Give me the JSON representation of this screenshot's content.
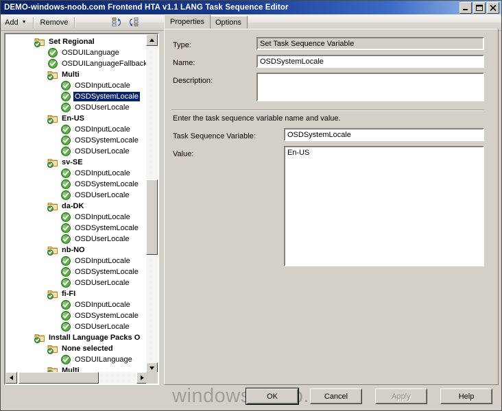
{
  "window": {
    "title": "DEMO-windows-noob.com Frontend HTA v1.1 LANG Task Sequence Editor",
    "minimize_label": "Minimize",
    "maximize_label": "Maximize",
    "close_label": "Close"
  },
  "toolbar": {
    "add_label": "Add",
    "add_caret": "▼",
    "remove_label": "Remove",
    "icon1_name": "move-up-icon",
    "icon2_name": "move-down-icon"
  },
  "tree": {
    "rows": [
      {
        "label": "Set Regional",
        "indent": 1,
        "type": "folder",
        "selected": false
      },
      {
        "label": "OSDUILanguage",
        "indent": 2,
        "type": "step",
        "selected": false
      },
      {
        "label": "OSDUILanguageFallback",
        "indent": 2,
        "type": "step",
        "selected": false
      },
      {
        "label": "Multi",
        "indent": 2,
        "type": "folder",
        "selected": false
      },
      {
        "label": "OSDInputLocale",
        "indent": 3,
        "type": "step",
        "selected": false
      },
      {
        "label": "OSDSystemLocale",
        "indent": 3,
        "type": "step",
        "selected": true
      },
      {
        "label": "OSDUserLocale",
        "indent": 3,
        "type": "step",
        "selected": false
      },
      {
        "label": "En-US",
        "indent": 2,
        "type": "folder",
        "selected": false
      },
      {
        "label": "OSDInputLocale",
        "indent": 3,
        "type": "step",
        "selected": false
      },
      {
        "label": "OSDSystemLocale",
        "indent": 3,
        "type": "step",
        "selected": false
      },
      {
        "label": "OSDUserLocale",
        "indent": 3,
        "type": "step",
        "selected": false
      },
      {
        "label": "sv-SE",
        "indent": 2,
        "type": "folder",
        "selected": false
      },
      {
        "label": "OSDInputLocale",
        "indent": 3,
        "type": "step",
        "selected": false
      },
      {
        "label": "OSDSystemLocale",
        "indent": 3,
        "type": "step",
        "selected": false
      },
      {
        "label": "OSDUserLocale",
        "indent": 3,
        "type": "step",
        "selected": false
      },
      {
        "label": "da-DK",
        "indent": 2,
        "type": "folder",
        "selected": false
      },
      {
        "label": "OSDInputLocale",
        "indent": 3,
        "type": "step",
        "selected": false
      },
      {
        "label": "OSDSystemLocale",
        "indent": 3,
        "type": "step",
        "selected": false
      },
      {
        "label": "OSDUserLocale",
        "indent": 3,
        "type": "step",
        "selected": false
      },
      {
        "label": "nb-NO",
        "indent": 2,
        "type": "folder",
        "selected": false
      },
      {
        "label": "OSDInputLocale",
        "indent": 3,
        "type": "step",
        "selected": false
      },
      {
        "label": "OSDSystemLocale",
        "indent": 3,
        "type": "step",
        "selected": false
      },
      {
        "label": "OSDUserLocale",
        "indent": 3,
        "type": "step",
        "selected": false
      },
      {
        "label": "fi-FI",
        "indent": 2,
        "type": "folder",
        "selected": false
      },
      {
        "label": "OSDInputLocale",
        "indent": 3,
        "type": "step",
        "selected": false
      },
      {
        "label": "OSDSystemLocale",
        "indent": 3,
        "type": "step",
        "selected": false
      },
      {
        "label": "OSDUserLocale",
        "indent": 3,
        "type": "step",
        "selected": false
      },
      {
        "label": "Install Language Packs O",
        "indent": 1,
        "type": "folder",
        "selected": false
      },
      {
        "label": "None selected",
        "indent": 2,
        "type": "folder",
        "selected": false
      },
      {
        "label": "OSDUILanguage",
        "indent": 3,
        "type": "step",
        "selected": false
      },
      {
        "label": "Multi",
        "indent": 2,
        "type": "folder",
        "selected": false
      }
    ]
  },
  "tabs": [
    {
      "label": "Properties",
      "active": true
    },
    {
      "label": "Options",
      "active": false
    }
  ],
  "properties": {
    "type_label": "Type:",
    "type_value": "Set Task Sequence Variable",
    "name_label": "Name:",
    "name_value": "OSDSystemLocale",
    "description_label": "Description:",
    "description_value": "",
    "instruction": "Enter the task sequence variable name and value.",
    "variable_label": "Task Sequence Variable:",
    "variable_value": "OSDSystemLocale",
    "value_label": "Value:",
    "value_value": "En-US"
  },
  "buttons": {
    "ok": "OK",
    "cancel": "Cancel",
    "apply": "Apply",
    "help": "Help"
  },
  "watermark": "windows-noob.com",
  "colors": {
    "title_gradient_start": "#0a246a",
    "title_gradient_end": "#a6c6ef",
    "selection": "#0a246a",
    "face": "#d4d0c8",
    "field": "#ffffff",
    "folder_icon": "#e8c16a",
    "step_icon": "#4aa03c"
  }
}
